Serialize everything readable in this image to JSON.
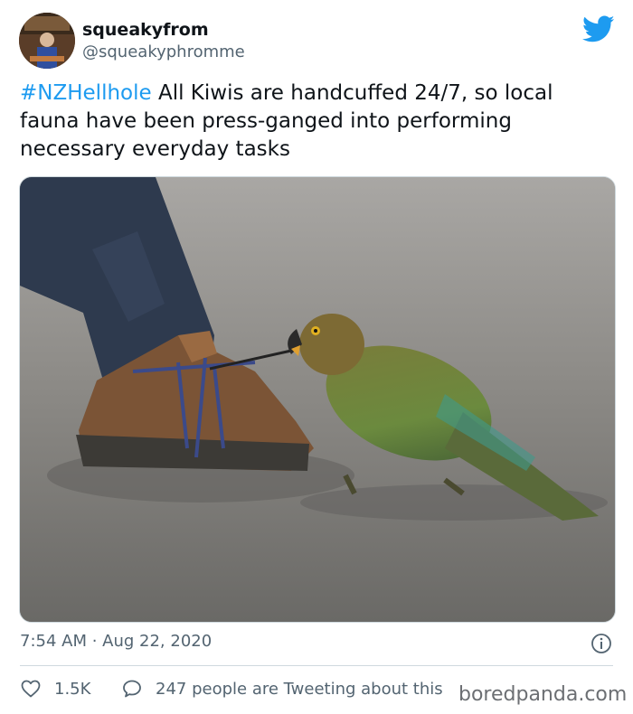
{
  "tweet": {
    "display_name": "squeakyfrom",
    "handle": "@squeakyphromme",
    "hashtag": "#NZHellhole",
    "body": " All Kiwis are handcuffed 24/7, so local fauna have been press-ganged into performing necessary everyday tasks",
    "timestamp": "7:54 AM · Aug 22, 2020",
    "likes": "1.5K",
    "replies_text": "247 people are Tweeting about this"
  },
  "icons": {
    "brand": "twitter-bird-icon",
    "info": "info-icon",
    "like": "heart-icon",
    "reply": "speech-bubble-icon"
  },
  "colors": {
    "accent": "#1d9bf0",
    "text": "#0f1419",
    "secondary_text": "#536471"
  },
  "watermark": "boredpanda.com"
}
